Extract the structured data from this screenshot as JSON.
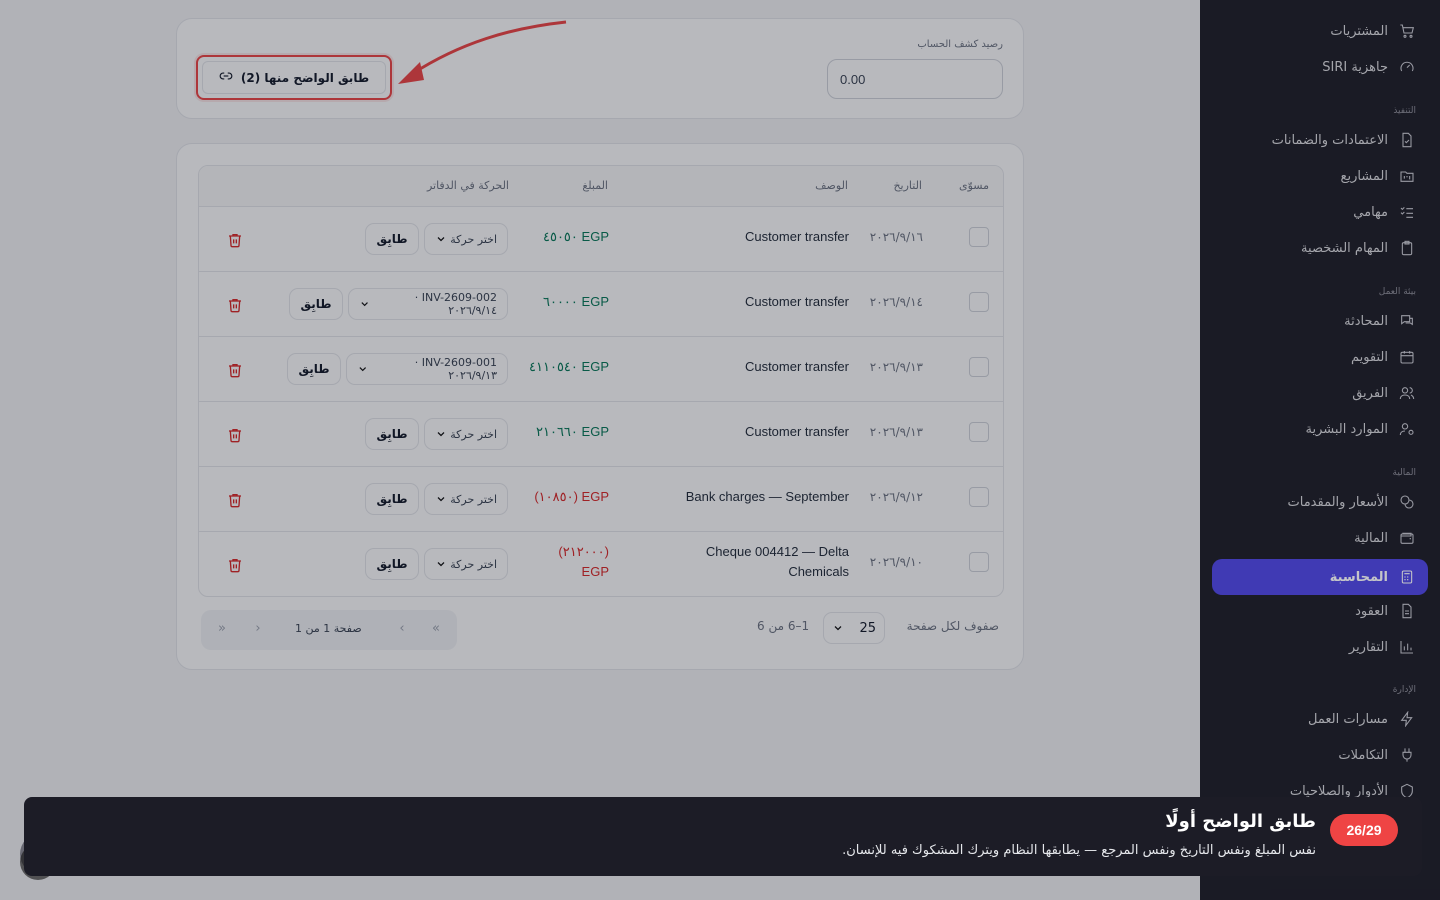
{
  "sidebar": {
    "items": [
      {
        "label": "المشتريات",
        "icon": "cart-icon",
        "active": false
      },
      {
        "label": "جاهزية SIRI",
        "icon": "gauge-icon",
        "active": false
      },
      {
        "label": "الاعتمادات والضمانات",
        "icon": "file-check-icon",
        "active": false
      },
      {
        "label": "المشاريع",
        "icon": "folder-kanban-icon",
        "active": false
      },
      {
        "label": "مهامي",
        "icon": "list-checks-icon",
        "active": false
      },
      {
        "label": "المهام الشخصية",
        "icon": "clipboard-icon",
        "active": false
      },
      {
        "label": "المحادثة",
        "icon": "chat-icon",
        "active": false
      },
      {
        "label": "التقويم",
        "icon": "calendar-icon",
        "active": false
      },
      {
        "label": "الفريق",
        "icon": "users-icon",
        "active": false
      },
      {
        "label": "الموارد البشرية",
        "icon": "user-cog-icon",
        "active": false
      },
      {
        "label": "الأسعار والمقدمات",
        "icon": "coins-icon",
        "active": false
      },
      {
        "label": "المالية",
        "icon": "wallet-icon",
        "active": false
      },
      {
        "label": "المحاسبة",
        "icon": "calculator-icon",
        "active": true
      },
      {
        "label": "العقود",
        "icon": "document-icon",
        "active": false
      },
      {
        "label": "التقارير",
        "icon": "bar-chart-icon",
        "active": false
      },
      {
        "label": "مسارات العمل",
        "icon": "zap-icon",
        "active": false
      },
      {
        "label": "التكاملات",
        "icon": "plug-icon",
        "active": false
      },
      {
        "label": "الأدوار والصلاحيات",
        "icon": "shield-icon",
        "active": false
      }
    ],
    "sections": [
      "التنفيذ",
      "بيئة العمل",
      "المالية",
      "الإدارة"
    ]
  },
  "balance": {
    "label": "رصيد كشف الحساب",
    "value": "0.00"
  },
  "match_obvious_button": "طابق الواضح منها (2)",
  "table": {
    "headers": {
      "reconciled": "مسوّى",
      "date": "التاريخ",
      "description": "الوصف",
      "amount": "المبلغ",
      "ledger_move": "الحركة في الدفاتر"
    },
    "rows": [
      {
        "date": "٢٠٢٦/٩/١٦",
        "description": "Customer transfer",
        "amount": "EGP ٤٥٠٥٠",
        "sign": "pos",
        "select": "اختر حركة",
        "match": "طابِق"
      },
      {
        "date": "٢٠٢٦/٩/١٤",
        "description": "Customer transfer",
        "amount": "EGP ٦٠٠٠٠",
        "sign": "pos",
        "select": "INV-2609-002 · ٢٠٢٦/٩/١٤",
        "match": "طابِق"
      },
      {
        "date": "٢٠٢٦/٩/١٣",
        "description": "Customer transfer",
        "amount": "EGP ٤١١٠٥٤٠",
        "sign": "pos",
        "select": "INV-2609-001 · ٢٠٢٦/٩/١٣",
        "match": "طابِق"
      },
      {
        "date": "٢٠٢٦/٩/١٣",
        "description": "Customer transfer",
        "amount": "EGP ٢١٠٦٦٠",
        "sign": "pos",
        "select": "اختر حركة",
        "match": "طابِق"
      },
      {
        "date": "٢٠٢٦/٩/١٢",
        "description": "Bank charges — September",
        "amount": "EGP (١٠٨٥٠)",
        "sign": "neg",
        "select": "اختر حركة",
        "match": "طابِق"
      },
      {
        "date": "٢٠٢٦/٩/١٠",
        "description_l1": "Cheque 004412 — Delta",
        "description_l2": "Chemicals",
        "amount_l1": "(٢١٢٠٠٠)",
        "amount_l2": "EGP",
        "sign": "neg",
        "select": "اختر حركة",
        "match": "طابِق"
      }
    ]
  },
  "pagination": {
    "rows_per_page_label": "صفوف لكل صفحة",
    "rows_per_page_value": "25",
    "range": "1–6 من 6",
    "page_text": "صفحة 1 من 1"
  },
  "tour": {
    "step": "26/29",
    "title": "طابق الواضح أولًا",
    "body": "نفس المبلغ ونفس التاريخ ونفس المرجع — يطابقها النظام ويترك المشكوك فيه للإنسان."
  },
  "colors": {
    "accent": "#4f46e5",
    "tour_badge": "#ef4444",
    "positive": "#047857",
    "negative": "#dc2626",
    "sidebar_bg": "#1c1c26"
  }
}
